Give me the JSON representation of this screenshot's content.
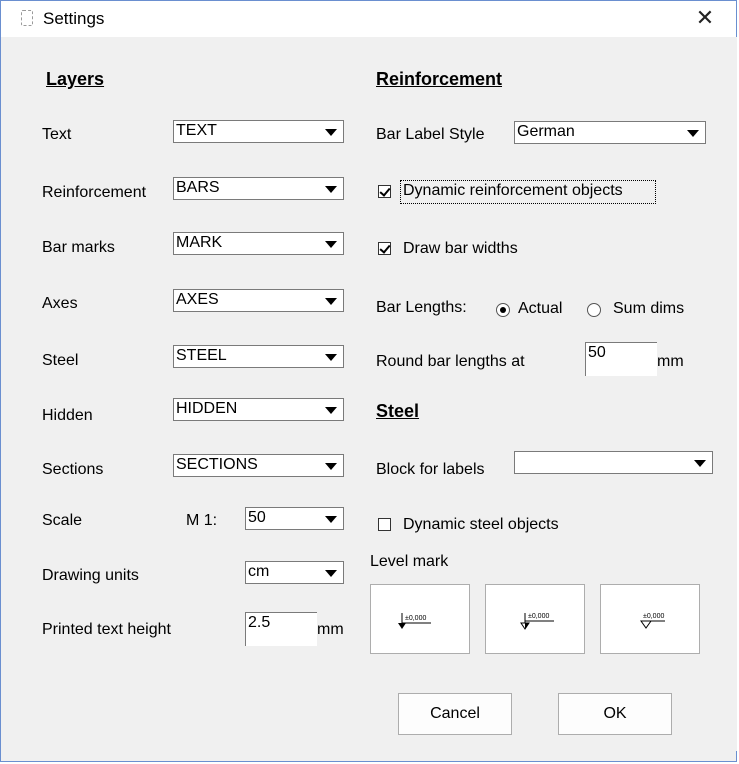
{
  "window": {
    "title": "Settings"
  },
  "layers": {
    "heading": "Layers",
    "rows": [
      {
        "label": "Text",
        "value": "TEXT"
      },
      {
        "label": "Reinforcement",
        "value": "BARS"
      },
      {
        "label": "Bar marks",
        "value": "MARK"
      },
      {
        "label": "Axes",
        "value": "AXES"
      },
      {
        "label": "Steel",
        "value": "STEEL"
      },
      {
        "label": "Hidden",
        "value": "HIDDEN"
      },
      {
        "label": "Sections",
        "value": "SECTIONS"
      }
    ],
    "scale": {
      "label": "Scale",
      "prefix": "M 1:",
      "value": "50"
    },
    "drawing_units": {
      "label": "Drawing units",
      "value": "cm"
    },
    "printed_text_height": {
      "label": "Printed text height",
      "value": "2.5",
      "unit": "mm"
    }
  },
  "reinforcement": {
    "heading": "Reinforcement",
    "bar_label_style": {
      "label": "Bar Label Style",
      "value": "German"
    },
    "dynamic_objects": {
      "label": "Dynamic reinforcement objects",
      "checked": true
    },
    "draw_widths": {
      "label": "Draw bar widths",
      "checked": true
    },
    "bar_lengths": {
      "label": "Bar Lengths:",
      "option_actual": "Actual",
      "option_sum": "Sum dims",
      "selected": "Actual"
    },
    "round": {
      "label": "Round bar lengths at",
      "value": "50",
      "unit": "mm"
    }
  },
  "steel": {
    "heading": "Steel",
    "block_for_labels": {
      "label": "Block for labels",
      "value": ""
    },
    "dynamic_objects": {
      "label": "Dynamic steel objects",
      "checked": false
    },
    "level_mark": {
      "label": "Level mark",
      "marks": [
        "±0,000",
        "±0,000",
        "±0,000"
      ]
    }
  },
  "buttons": {
    "cancel": "Cancel",
    "ok": "OK"
  }
}
